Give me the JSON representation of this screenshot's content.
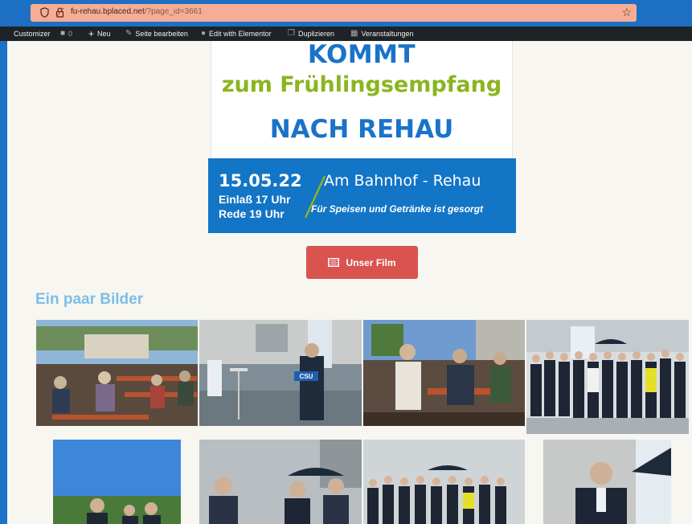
{
  "browser": {
    "url_host": "fu-rehau.bplaced.net",
    "url_path": "/?page_id=3661"
  },
  "adminbar": {
    "customizer": "Customizer",
    "comments_count": "0",
    "new": "Neu",
    "edit_page": "Seite bearbeiten",
    "elementor": "Edit with Elementor",
    "duplicate": "Duplizieren",
    "events": "Veranstaltungen"
  },
  "poster": {
    "line1": "KOMMT",
    "line2": "zum Frühlingsempfang",
    "line3": "NACH REHAU",
    "date": "15.05.22",
    "entry": "Einlaß 17 Uhr",
    "speech": "Rede 19 Uhr",
    "place": "Am Bahnhof - Rehau",
    "food": "Für Speisen und Getränke ist gesorgt"
  },
  "film_button": {
    "label": "Unser Film"
  },
  "gallery": {
    "title": "Ein paar Bilder",
    "stage_sign": "CSU"
  },
  "colors": {
    "brand_blue": "#1275c6",
    "green": "#8ab51f",
    "button_red": "#d9534f",
    "heading_light_blue": "#7dbde8"
  }
}
